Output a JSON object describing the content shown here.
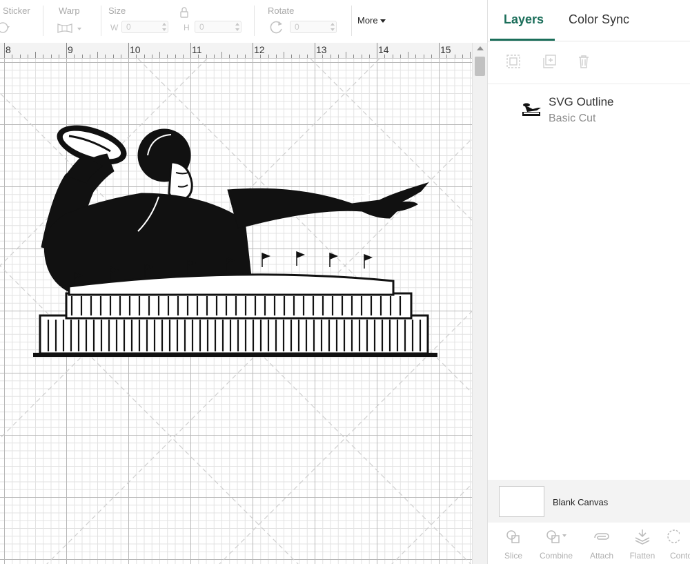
{
  "toolbar": {
    "sticker_label": "Sticker",
    "warp_label": "Warp",
    "size_label": "Size",
    "width_prefix": "W",
    "width_value": "0",
    "height_prefix": "H",
    "height_value": "0",
    "rotate_label": "Rotate",
    "rotate_value": "0",
    "more_label": "More"
  },
  "ruler": {
    "numbers": [
      "8",
      "9",
      "10",
      "11",
      "12",
      "13",
      "14",
      "15"
    ]
  },
  "panel": {
    "tabs": {
      "layers": "Layers",
      "color_sync": "Color Sync"
    },
    "layer": {
      "name": "SVG Outline",
      "operation": "Basic Cut"
    },
    "blank_canvas": "Blank Canvas",
    "tools": {
      "slice": "Slice",
      "combine": "Combine",
      "attach": "Attach",
      "flatten": "Flatten",
      "contour": "Contour"
    }
  },
  "colors": {
    "accent": "#1b6e5a",
    "artwork": "#111111"
  }
}
